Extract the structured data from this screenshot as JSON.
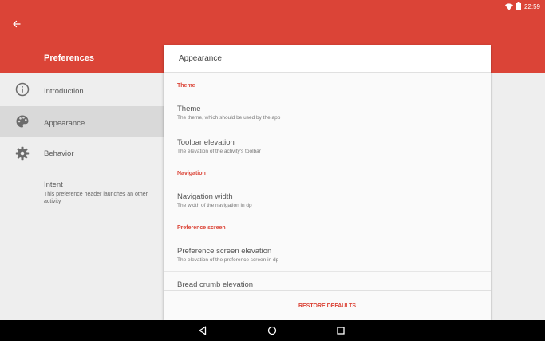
{
  "status_bar": {
    "time": "22:59"
  },
  "app_bar": {
    "title": "Preferences"
  },
  "nav": {
    "items": [
      {
        "label": "Introduction",
        "icon": "info-icon"
      },
      {
        "label": "Appearance",
        "icon": "palette-icon",
        "selected": true
      },
      {
        "label": "Behavior",
        "icon": "gear-icon"
      },
      {
        "label": "Intent",
        "summary": "This preference header launches an other activity"
      }
    ]
  },
  "detail": {
    "title": "Appearance",
    "sections": [
      {
        "header": "Theme"
      },
      {
        "header": "Navigation"
      },
      {
        "header": "Preference screen"
      }
    ],
    "prefs": [
      {
        "title": "Theme",
        "summary": "The theme, which should be used by the app"
      },
      {
        "title": "Toolbar elevation",
        "summary": "The elevation of the activity's toolbar"
      },
      {
        "title": "Navigation width",
        "summary": "The width of the navigation in dp"
      },
      {
        "title": "Preference screen elevation",
        "summary": "The elevation of the preference screen in dp"
      },
      {
        "title": "Bread crumb elevation"
      }
    ],
    "restore_label": "RESTORE DEFAULTS"
  },
  "colors": {
    "accent": "#db4437",
    "background": "#eeeeee",
    "selected": "#d9d9d9",
    "card": "#fafafa"
  }
}
